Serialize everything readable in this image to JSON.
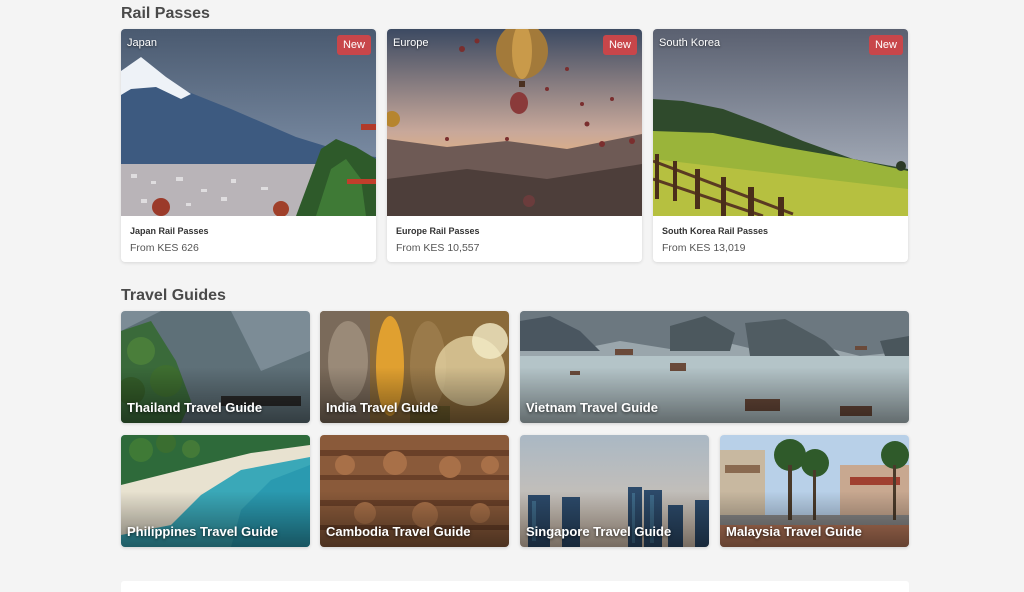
{
  "rail_passes": {
    "title": "Rail Passes",
    "cards": [
      {
        "country": "Japan",
        "badge": "New",
        "name": "Japan Rail Passes",
        "price": "From KES 626"
      },
      {
        "country": "Europe",
        "badge": "New",
        "name": "Europe Rail Passes",
        "price": "From KES 10,557"
      },
      {
        "country": "South Korea",
        "badge": "New",
        "name": "South Korea Rail Passes",
        "price": "From KES 13,019"
      }
    ]
  },
  "travel_guides": {
    "title": "Travel Guides",
    "cards": [
      {
        "label": "Thailand Travel Guide"
      },
      {
        "label": "India Travel Guide"
      },
      {
        "label": "Vietnam Travel Guide"
      },
      {
        "label": "Philippines Travel Guide"
      },
      {
        "label": "Cambodia Travel Guide"
      },
      {
        "label": "Singapore Travel Guide"
      },
      {
        "label": "Malaysia Travel Guide"
      }
    ]
  },
  "colors": {
    "badge": "#c8464a",
    "background": "#f4f4f4"
  }
}
